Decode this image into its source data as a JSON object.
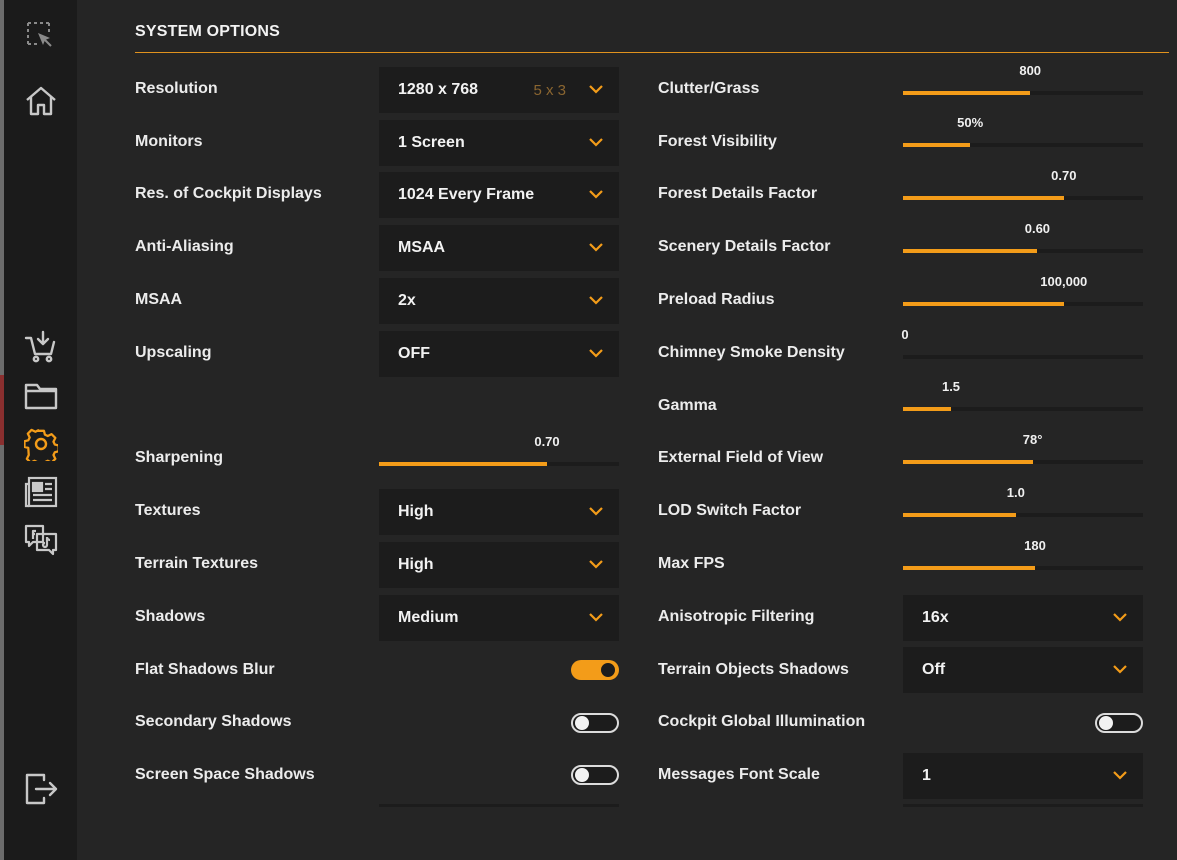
{
  "title": "SYSTEM OPTIONS",
  "accent_color": "#f39c19",
  "sidebar": {
    "icons": [
      "select-region-icon",
      "home-icon",
      "cart-download-icon",
      "folder-icon",
      "settings-gear-icon",
      "news-icon",
      "social-chat-icon",
      "exit-icon"
    ],
    "active": "settings-gear-icon"
  },
  "left": {
    "resolution": {
      "label": "Resolution",
      "value": "1280 x 768",
      "hint": "5 x 3"
    },
    "monitors": {
      "label": "Monitors",
      "value": "1 Screen"
    },
    "cockpit_displays": {
      "label": "Res. of Cockpit Displays",
      "value": "1024 Every Frame"
    },
    "anti_aliasing": {
      "label": "Anti-Aliasing",
      "value": "MSAA"
    },
    "msaa": {
      "label": "MSAA",
      "value": "2x"
    },
    "upscaling": {
      "label": "Upscaling",
      "value": "OFF"
    },
    "sharpening": {
      "label": "Sharpening",
      "value": "0.70",
      "level": 0.7
    },
    "textures": {
      "label": "Textures",
      "value": "High"
    },
    "terrain_textures": {
      "label": "Terrain Textures",
      "value": "High"
    },
    "shadows": {
      "label": "Shadows",
      "value": "Medium"
    },
    "flat_shadows_blur": {
      "label": "Flat Shadows Blur",
      "on": true
    },
    "secondary_shadows": {
      "label": "Secondary Shadows",
      "on": false
    },
    "screen_space_shadows": {
      "label": "Screen Space Shadows",
      "on": false
    }
  },
  "right": {
    "clutter_grass": {
      "label": "Clutter/Grass",
      "value": "800",
      "level": 0.53
    },
    "forest_visibility": {
      "label": "Forest Visibility",
      "value": "50%",
      "level": 0.28
    },
    "forest_details": {
      "label": "Forest Details Factor",
      "value": "0.70",
      "level": 0.67
    },
    "scenery_details": {
      "label": "Scenery Details Factor",
      "value": "0.60",
      "level": 0.56
    },
    "preload_radius": {
      "label": "Preload Radius",
      "value": "100,000",
      "level": 0.67
    },
    "chimney_smoke": {
      "label": "Chimney Smoke Density",
      "value": "0",
      "level": 0.0
    },
    "gamma": {
      "label": "Gamma",
      "value": "1.5",
      "level": 0.2
    },
    "external_fov": {
      "label": "External Field of View",
      "value": "78°",
      "level": 0.54
    },
    "lod_switch": {
      "label": "LOD Switch Factor",
      "value": "1.0",
      "level": 0.47
    },
    "max_fps": {
      "label": "Max FPS",
      "value": "180",
      "level": 0.55
    },
    "anisotropic": {
      "label": "Anisotropic Filtering",
      "value": "16x"
    },
    "terrain_objects_shadows": {
      "label": "Terrain Objects Shadows",
      "value": "Off"
    },
    "cockpit_gi": {
      "label": "Cockpit Global Illumination",
      "on": false
    },
    "messages_font_scale": {
      "label": "Messages Font Scale",
      "value": "1"
    }
  }
}
